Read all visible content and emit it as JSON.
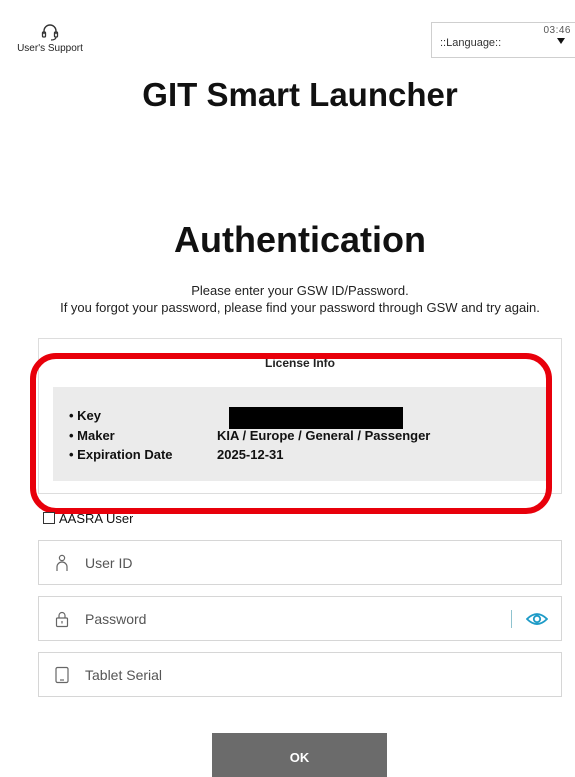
{
  "header": {
    "support_label": "User's Support",
    "language_label": "::Language::",
    "clock": "03:46"
  },
  "app_title": "GIT Smart Launcher",
  "auth": {
    "title": "Authentication",
    "instruction_1": "Please enter your GSW ID/Password.",
    "instruction_2": "If you forgot your password, please find your password through GSW and try again."
  },
  "license": {
    "title": "License Info",
    "rows": [
      {
        "label": "• Key",
        "value": ""
      },
      {
        "label": "• Maker",
        "value": "KIA / Europe / General / Passenger"
      },
      {
        "label": "• Expiration Date",
        "value": "2025-12-31"
      }
    ]
  },
  "form": {
    "aasra_label": "AASRA User",
    "user_id_placeholder": "User ID",
    "password_placeholder": "Password",
    "tablet_serial_placeholder": "Tablet Serial",
    "ok_label": "OK"
  },
  "colors": {
    "highlight": "#e8000b",
    "accent_eye": "#1e9bc7",
    "button_bg": "#6b6b6b"
  }
}
